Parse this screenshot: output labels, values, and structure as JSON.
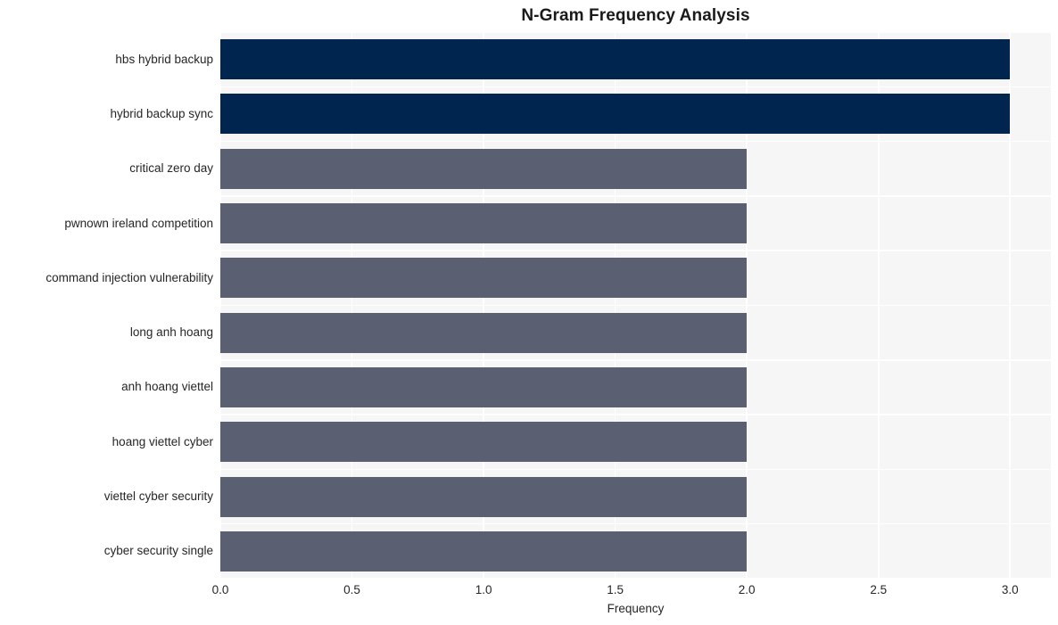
{
  "chart_data": {
    "type": "bar",
    "orientation": "horizontal",
    "title": "N-Gram Frequency Analysis",
    "xlabel": "Frequency",
    "ylabel": "",
    "categories": [
      "hbs hybrid backup",
      "hybrid backup sync",
      "critical zero day",
      "pwnown ireland competition",
      "command injection vulnerability",
      "long anh hoang",
      "anh hoang viettel",
      "hoang viettel cyber",
      "viettel cyber security",
      "cyber security single"
    ],
    "values": [
      3,
      3,
      2,
      2,
      2,
      2,
      2,
      2,
      2,
      2
    ],
    "bar_colors": [
      "#00264f",
      "#00264f",
      "#5a5f71",
      "#5a5f71",
      "#5a5f71",
      "#5a5f71",
      "#5a5f71",
      "#5a5f71",
      "#5a5f71",
      "#5a5f71"
    ],
    "xlim": [
      0,
      3.155
    ],
    "xticks": [
      0.0,
      0.5,
      1.0,
      1.5,
      2.0,
      2.5,
      3.0
    ],
    "xtick_labels": [
      "0.0",
      "0.5",
      "1.0",
      "1.5",
      "2.0",
      "2.5",
      "3.0"
    ],
    "grid": true,
    "grid_color": "#ffffff",
    "plot_background": "#f6f6f7",
    "figure_background": "#ffffff",
    "legend": null,
    "legend_position": "none",
    "text_color": "#262626",
    "title_color": "#1a1a1a"
  }
}
